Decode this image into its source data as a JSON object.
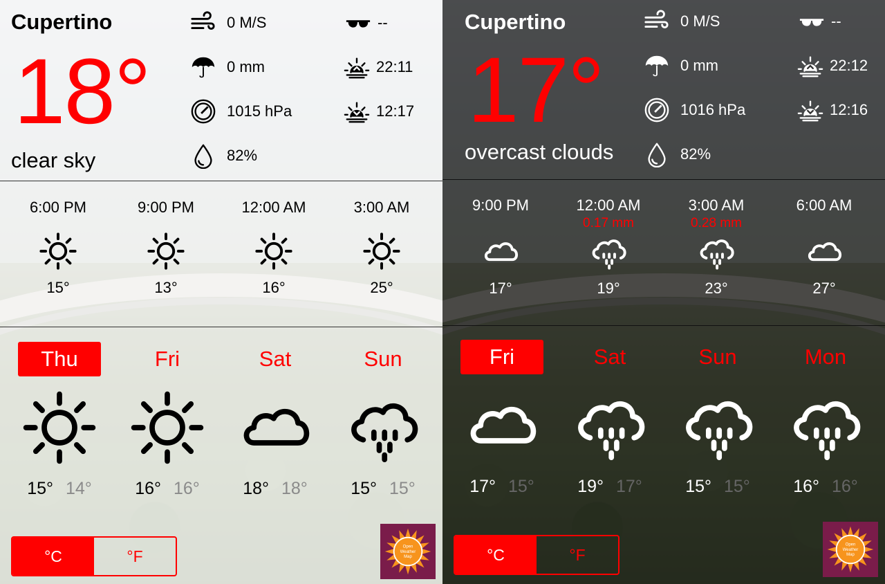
{
  "colors": {
    "accent": "#ff0000",
    "owm_bg": "#7a1c4a",
    "owm_sun": "#f7941d"
  },
  "panels": [
    {
      "theme": "light",
      "city": "Cupertino",
      "temp": "18°",
      "condition": "clear sky",
      "stats": {
        "wind": "0 M/S",
        "visibility": "--",
        "precipitation": "0 mm",
        "sunrise": "22:11",
        "pressure": "1015 hPa",
        "sunset": "12:17",
        "humidity": "82%"
      },
      "hourly": [
        {
          "time": "6:00 PM",
          "rain": "",
          "icon": "sun-icon",
          "temp": "15°"
        },
        {
          "time": "9:00 PM",
          "rain": "",
          "icon": "sun-icon",
          "temp": "13°"
        },
        {
          "time": "12:00 AM",
          "rain": "",
          "icon": "sun-icon",
          "temp": "16°"
        },
        {
          "time": "3:00 AM",
          "rain": "",
          "icon": "sun-icon",
          "temp": "25°"
        }
      ],
      "daily": [
        {
          "day": "Thu",
          "icon": "sun-icon",
          "hi": "15°",
          "lo": "14°"
        },
        {
          "day": "Fri",
          "icon": "sun-icon",
          "hi": "16°",
          "lo": "16°"
        },
        {
          "day": "Sat",
          "icon": "cloud-icon",
          "hi": "18°",
          "lo": "18°"
        },
        {
          "day": "Sun",
          "icon": "rain-cloud-icon",
          "hi": "15°",
          "lo": "15°"
        }
      ],
      "units": {
        "celsius": "°C",
        "fahrenheit": "°F",
        "selected": "celsius"
      },
      "owm_logo": {
        "line1": "Open",
        "line2": "Weather",
        "line3": "Map"
      }
    },
    {
      "theme": "dark",
      "city": "Cupertino",
      "temp": "17°",
      "condition": "overcast clouds",
      "stats": {
        "wind": "0 M/S",
        "visibility": "--",
        "precipitation": "0 mm",
        "sunrise": "22:12",
        "pressure": "1016 hPa",
        "sunset": "12:16",
        "humidity": "82%"
      },
      "hourly": [
        {
          "time": "9:00 PM",
          "rain": "",
          "icon": "cloud-icon",
          "temp": "17°"
        },
        {
          "time": "12:00 AM",
          "rain": "0.17 mm",
          "icon": "rain-cloud-icon",
          "temp": "19°"
        },
        {
          "time": "3:00 AM",
          "rain": "0.28 mm",
          "icon": "rain-cloud-icon",
          "temp": "23°"
        },
        {
          "time": "6:00 AM",
          "rain": "",
          "icon": "cloud-icon",
          "temp": "27°"
        }
      ],
      "daily": [
        {
          "day": "Fri",
          "icon": "cloud-icon",
          "hi": "17°",
          "lo": "15°"
        },
        {
          "day": "Sat",
          "icon": "rain-cloud-icon",
          "hi": "19°",
          "lo": "17°"
        },
        {
          "day": "Sun",
          "icon": "rain-cloud-icon",
          "hi": "15°",
          "lo": "15°"
        },
        {
          "day": "Mon",
          "icon": "rain-cloud-icon",
          "hi": "16°",
          "lo": "16°"
        }
      ],
      "units": {
        "celsius": "°C",
        "fahrenheit": "°F",
        "selected": "celsius"
      },
      "owm_logo": {
        "line1": "Open",
        "line2": "Weather",
        "line3": "Map"
      }
    }
  ]
}
